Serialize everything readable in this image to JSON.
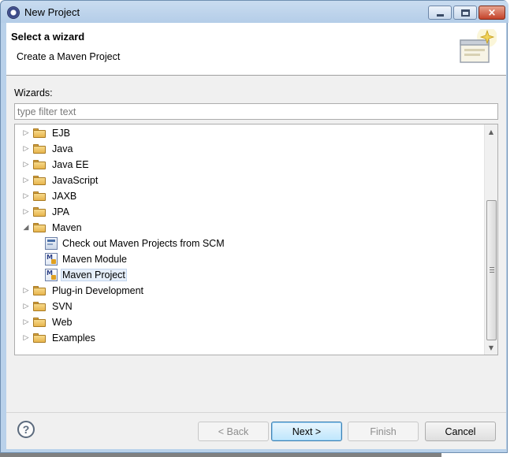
{
  "window": {
    "title": "New Project",
    "controls": {
      "minimize": "minimize",
      "maximize": "maximize",
      "close": "×"
    }
  },
  "header": {
    "title": "Select a wizard",
    "description": "Create a Maven Project",
    "banner_icon": "wizard-banner-icon"
  },
  "wizards": {
    "label": "Wizards:",
    "filter_placeholder": "type filter text",
    "filter_value": ""
  },
  "tree": {
    "items": [
      {
        "label": "EJB",
        "type": "folder",
        "expanded": false,
        "level": 0
      },
      {
        "label": "Java",
        "type": "folder",
        "expanded": false,
        "level": 0
      },
      {
        "label": "Java EE",
        "type": "folder",
        "expanded": false,
        "level": 0
      },
      {
        "label": "JavaScript",
        "type": "folder",
        "expanded": false,
        "level": 0
      },
      {
        "label": "JAXB",
        "type": "folder",
        "expanded": false,
        "level": 0
      },
      {
        "label": "JPA",
        "type": "folder",
        "expanded": false,
        "level": 0
      },
      {
        "label": "Maven",
        "type": "folder",
        "expanded": true,
        "level": 0
      },
      {
        "label": "Check out Maven Projects from SCM",
        "type": "wizard",
        "icon": "scm-checkout-icon",
        "level": 1
      },
      {
        "label": "Maven Module",
        "type": "wizard",
        "icon": "maven-module-icon",
        "level": 1
      },
      {
        "label": "Maven Project",
        "type": "wizard",
        "icon": "maven-project-icon",
        "level": 1,
        "selected": true
      },
      {
        "label": "Plug-in Development",
        "type": "folder",
        "expanded": false,
        "level": 0
      },
      {
        "label": "SVN",
        "type": "folder",
        "expanded": false,
        "level": 0
      },
      {
        "label": "Web",
        "type": "folder",
        "expanded": false,
        "level": 0
      },
      {
        "label": "Examples",
        "type": "folder",
        "expanded": false,
        "level": 0
      }
    ]
  },
  "buttons": {
    "help": "?",
    "back": "< Back",
    "next": "Next >",
    "finish": "Finish",
    "cancel": "Cancel"
  },
  "colors": {
    "title_bar": "#b9d1ea",
    "dialog_bg": "#f0f0f0",
    "folder": "#e8b54d",
    "selection": "#e5eef9"
  }
}
